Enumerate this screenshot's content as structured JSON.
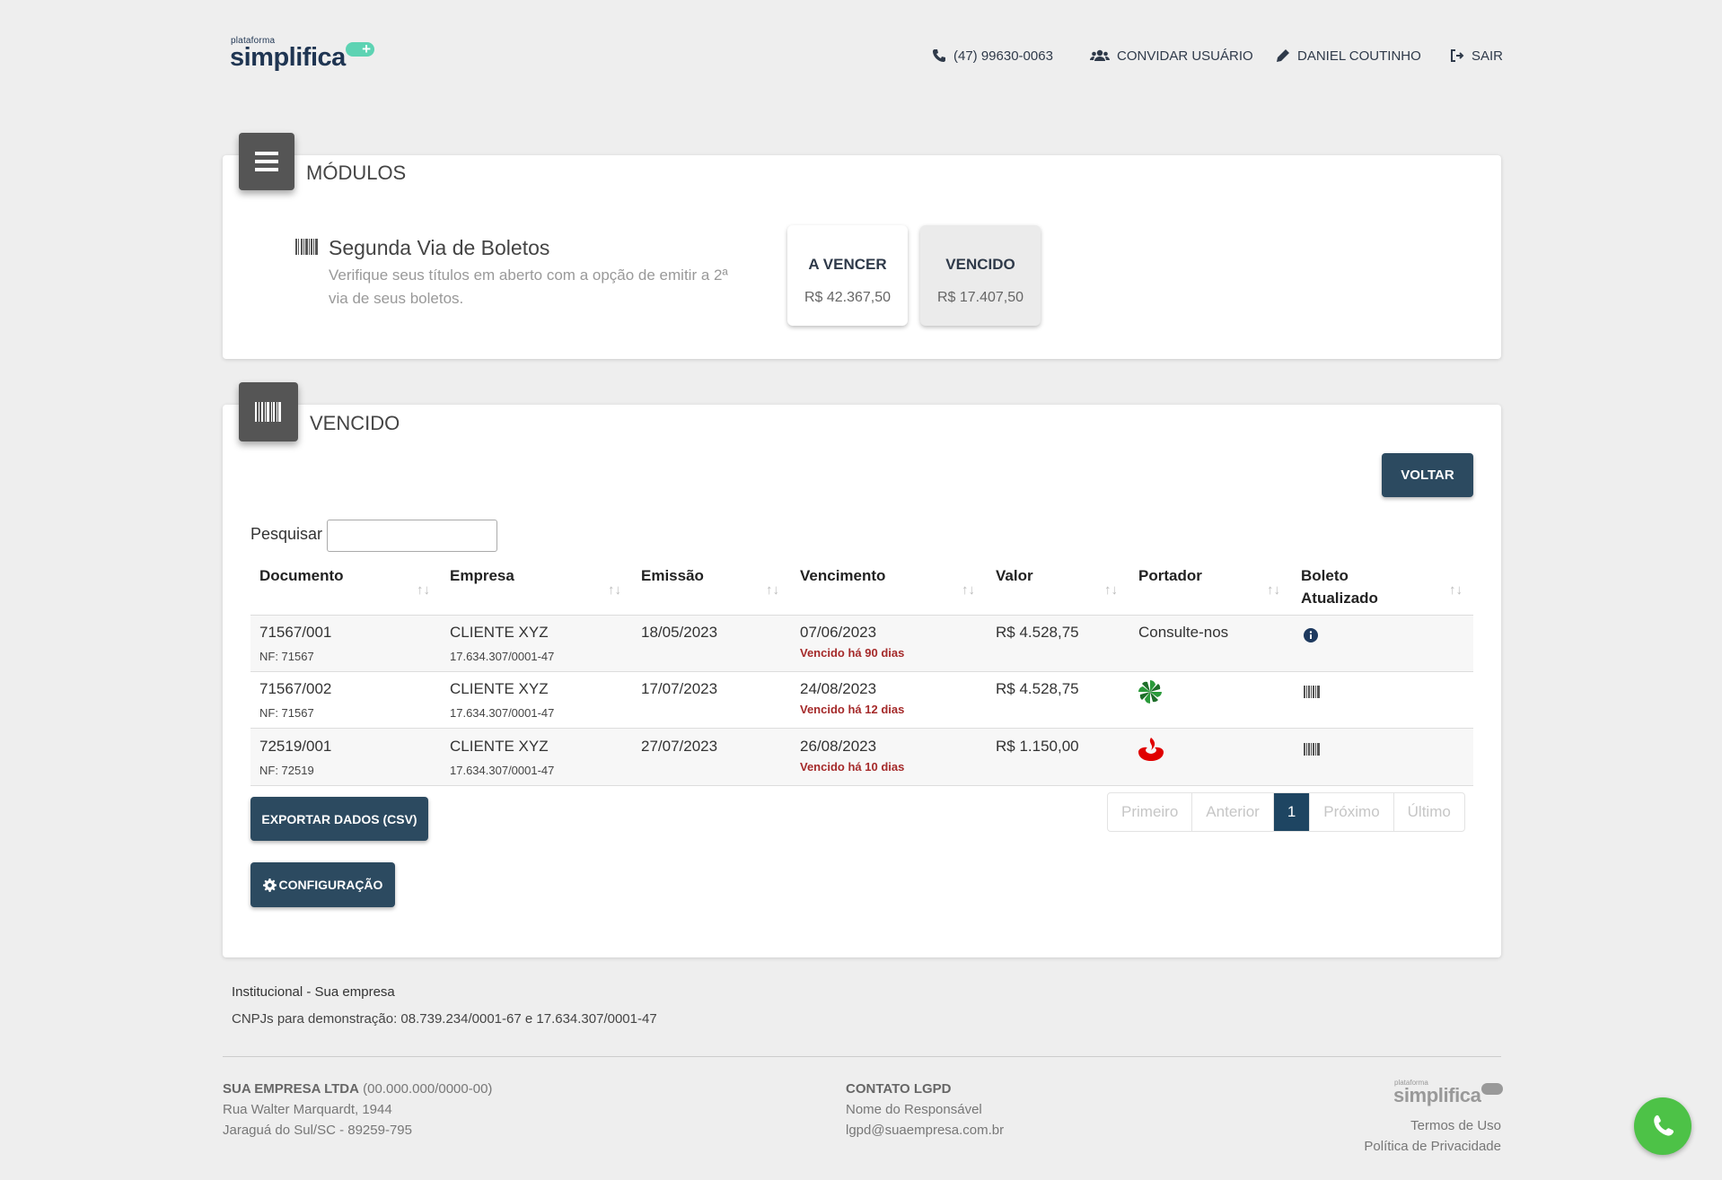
{
  "header": {
    "logo_small": "plataforma",
    "logo_big": "simplifica",
    "phone": "(47) 99630-0063",
    "invite": "CONVIDAR USUÁRIO",
    "user": "DANIEL COUTINHO",
    "logout": "SAIR"
  },
  "modules": {
    "title": "MÓDULOS",
    "item_title": "Segunda Via de Boletos",
    "item_desc": "Verifique seus títulos em aberto com a opção de emitir a 2ª via de seus boletos.",
    "tiles": [
      {
        "label": "A VENCER",
        "value": "R$ 42.367,50"
      },
      {
        "label": "VENCIDO",
        "value": "R$ 17.407,50"
      }
    ]
  },
  "vencido": {
    "title": "VENCIDO",
    "back_button": "VOLTAR",
    "search_label": "Pesquisar",
    "search_value": "",
    "columns": [
      "Documento",
      "Empresa",
      "Emissão",
      "Vencimento",
      "Valor",
      "Portador",
      "Boleto Atualizado"
    ],
    "rows": [
      {
        "doc": "71567/001",
        "nf": "NF: 71567",
        "empresa": "CLIENTE XYZ",
        "cnpj": "17.634.307/0001-47",
        "emissao": "18/05/2023",
        "vencimento": "07/06/2023",
        "status": "Vencido há 90 dias",
        "valor": "R$ 4.528,75",
        "portador": "Consulte-nos",
        "boleto_icon": "info-icon"
      },
      {
        "doc": "71567/002",
        "nf": "NF: 71567",
        "empresa": "CLIENTE XYZ",
        "cnpj": "17.634.307/0001-47",
        "emissao": "17/07/2023",
        "vencimento": "24/08/2023",
        "status": "Vencido há 12 dias",
        "valor": "R$ 4.528,75",
        "portador": "",
        "portador_icon": "bank-logo-green-icon",
        "boleto_icon": "barcode-icon"
      },
      {
        "doc": "72519/001",
        "nf": "NF: 72519",
        "empresa": "CLIENTE XYZ",
        "cnpj": "17.634.307/0001-47",
        "emissao": "27/07/2023",
        "vencimento": "26/08/2023",
        "status": "Vencido há 10 dias",
        "valor": "R$ 1.150,00",
        "portador": "",
        "portador_icon": "bank-logo-red-icon",
        "boleto_icon": "barcode-icon"
      }
    ],
    "export_button": "EXPORTAR DADOS (CSV)",
    "config_button": "CONFIGURAÇÃO",
    "pagination": [
      "Primeiro",
      "Anterior",
      "1",
      "Próximo",
      "Último"
    ]
  },
  "institutional": {
    "title": "Institucional - Sua empresa",
    "cnpjs": "CNPJs para demonstração: 08.739.234/0001-67 e 17.634.307/0001-47"
  },
  "footer": {
    "company": "SUA EMPRESA LTDA",
    "company_cnpj": "(00.000.000/0000-00)",
    "address1": "Rua Walter Marquardt, 1944",
    "address2": "Jaraguá do Sul/SC - 89259-795",
    "lgpd_title": "CONTATO LGPD",
    "lgpd_name": "Nome do Responsável",
    "lgpd_email": "lgpd@suaempresa.com.br",
    "logo_small": "plataforma",
    "logo_big": "simplifica",
    "terms": "Termos de Uso",
    "privacy": "Política de Privacidade"
  },
  "colors": {
    "primary_button": "#2c4a60",
    "active_page": "#1e4562",
    "overdue": "#a52a2a",
    "whatsapp": "#4dc247",
    "logo_accent": "#5dd3b3"
  }
}
